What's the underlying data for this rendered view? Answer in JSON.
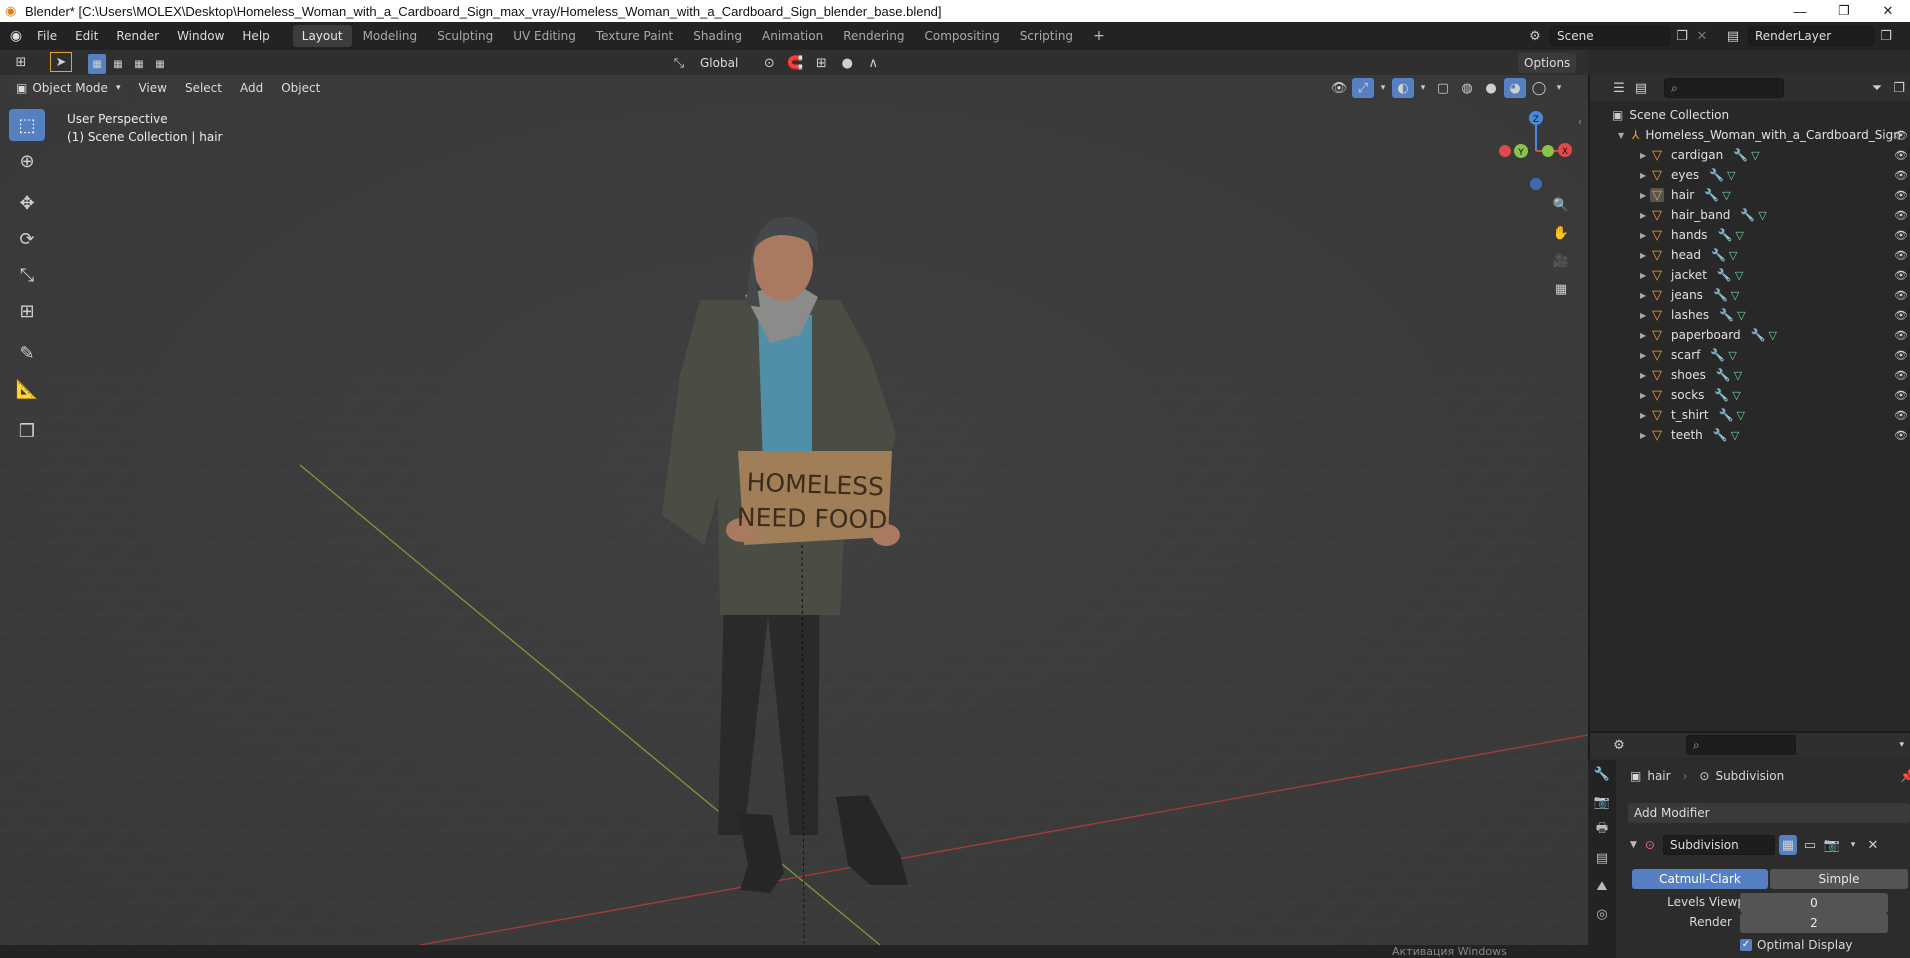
{
  "window": {
    "title": "Blender* [C:\\Users\\MOLEX\\Desktop\\Homeless_Woman_with_a_Cardboard_Sign_max_vray/Homeless_Woman_with_a_Cardboard_Sign_blender_base.blend]"
  },
  "menu": [
    "File",
    "Edit",
    "Render",
    "Window",
    "Help"
  ],
  "workspaces": [
    "Layout",
    "Modeling",
    "Sculpting",
    "UV Editing",
    "Texture Paint",
    "Shading",
    "Animation",
    "Rendering",
    "Compositing",
    "Scripting"
  ],
  "scene": {
    "scene_name": "Scene",
    "view_layer": "RenderLayer"
  },
  "toolheader": {
    "transform_orientation": "Global",
    "options_label": "Options"
  },
  "viewport_header": {
    "mode": "Object Mode",
    "menus": [
      "View",
      "Select",
      "Add",
      "Object"
    ]
  },
  "viewport": {
    "perspective_label": "User Perspective",
    "collection_label": "(1) Scene Collection | hair",
    "sign_line1": "HOMELESS",
    "sign_line2": "NEED FOOD",
    "gizmo": {
      "z": "Z",
      "y": "Y",
      "x": "X"
    }
  },
  "outliner": {
    "root": "Scene Collection",
    "collection": "Homeless_Woman_with_a_Cardboard_Sign",
    "objects": [
      "cardigan",
      "eyes",
      "hair",
      "hair_band",
      "hands",
      "head",
      "jacket",
      "jeans",
      "lashes",
      "paperboard",
      "scarf",
      "shoes",
      "socks",
      "t_shirt",
      "teeth"
    ],
    "selected": "hair"
  },
  "properties": {
    "object_name": "hair",
    "modifier_breadcrumb": "Subdivision",
    "add_modifier": "Add Modifier",
    "modifier_name": "Subdivision",
    "mode_catmull": "Catmull-Clark",
    "mode_simple": "Simple",
    "levels_viewport_label": "Levels Viewport",
    "levels_viewport_value": "0",
    "render_label": "Render",
    "render_value": "2",
    "optimal_display_label": "Optimal Display"
  },
  "statusbar": {
    "watermark": "Активация Windows"
  },
  "colors": {
    "accent": "#5680c2",
    "object_orange": "#f0a030",
    "mesh_green": "#6fd3a4",
    "modifier_blue": "#7fa3e0"
  }
}
